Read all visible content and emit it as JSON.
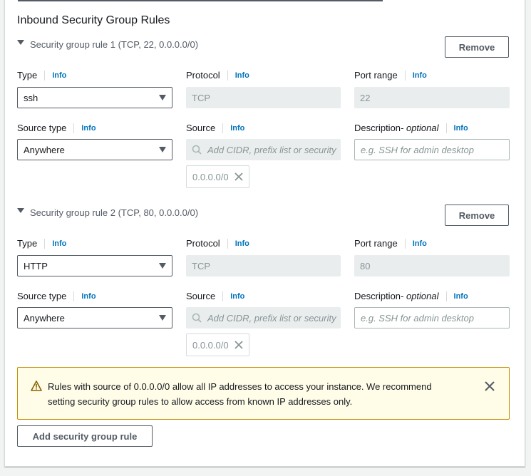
{
  "section_title": "Inbound Security Group Rules",
  "remove_label": "Remove",
  "info_label": "Info",
  "labels": {
    "type": "Type",
    "protocol": "Protocol",
    "port_range": "Port range",
    "source_type": "Source type",
    "source": "Source",
    "description": "Description",
    "optional": " - optional"
  },
  "rules": [
    {
      "title": "Security group rule 1 (TCP, 22, 0.0.0.0/0)",
      "type": "ssh",
      "protocol": "TCP",
      "port_range": "22",
      "source_type": "Anywhere",
      "source_placeholder": "Add CIDR, prefix list or security",
      "source_token": "0.0.0.0/0",
      "description_placeholder": "e.g. SSH for admin desktop"
    },
    {
      "title": "Security group rule 2 (TCP, 80, 0.0.0.0/0)",
      "type": "HTTP",
      "protocol": "TCP",
      "port_range": "80",
      "source_type": "Anywhere",
      "source_placeholder": "Add CIDR, prefix list or security",
      "source_token": "0.0.0.0/0",
      "description_placeholder": "e.g. SSH for admin desktop"
    }
  ],
  "alert": {
    "line1": "Rules with source of 0.0.0.0/0 allow all IP addresses to access your instance. We recommend",
    "line2": "setting security group rules to allow access from known IP addresses only.",
    "color": "#c58c00"
  },
  "add_rule_label": "Add security group rule"
}
